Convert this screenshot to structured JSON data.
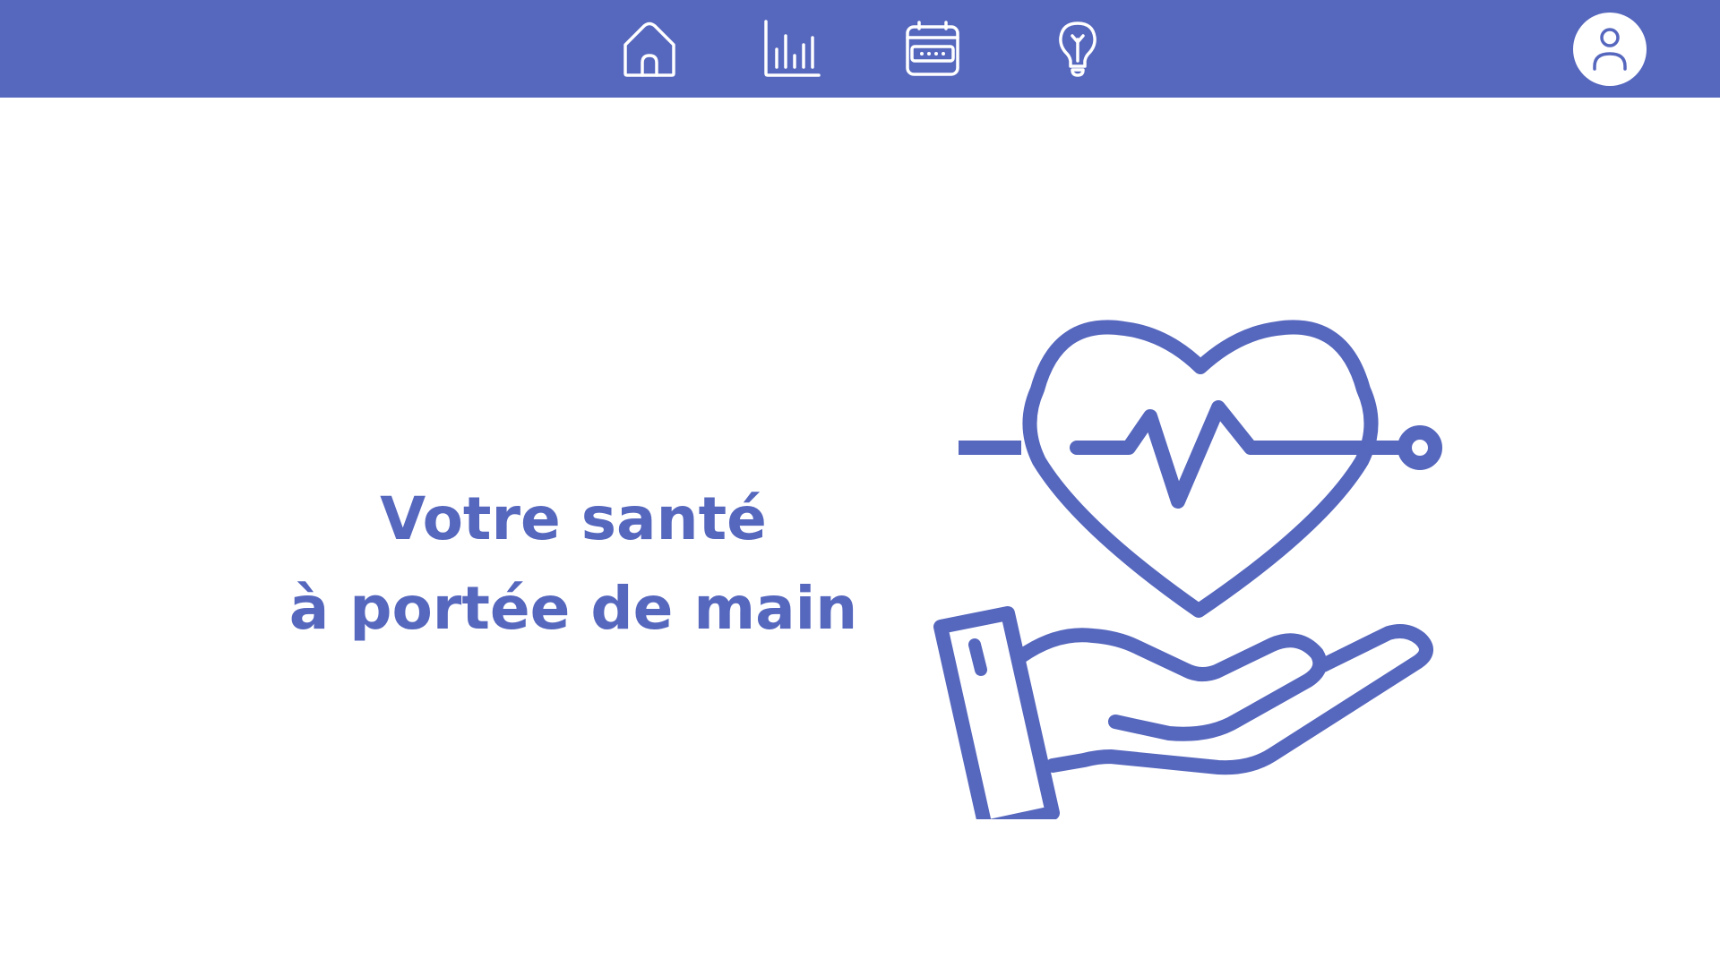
{
  "colors": {
    "brand": "#5667be",
    "background": "#ffffff",
    "icon_on_bar": "#ffffff"
  },
  "nav": {
    "items": [
      {
        "icon": "home-icon"
      },
      {
        "icon": "bar-chart-icon"
      },
      {
        "icon": "calendar-icon"
      },
      {
        "icon": "lightbulb-icon"
      }
    ],
    "profile_icon": "user-icon"
  },
  "hero": {
    "line1": "Votre santé",
    "line2": "à portée de main",
    "illustration_icon": "heart-pulse-in-hand-icon"
  }
}
